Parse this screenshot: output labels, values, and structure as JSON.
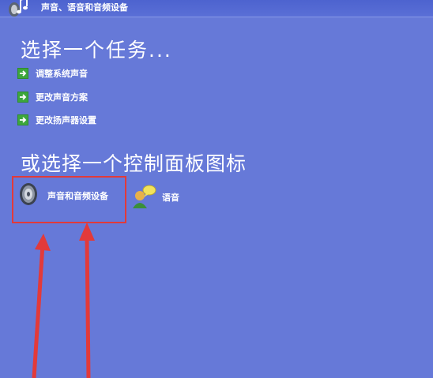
{
  "window": {
    "title": "声音、语音和音频设备"
  },
  "tasks": {
    "heading": "选择一个任务...",
    "items": [
      {
        "label": "调整系统声音"
      },
      {
        "label": "更改声音方案"
      },
      {
        "label": "更改扬声器设置"
      }
    ]
  },
  "control_panel": {
    "heading": "或选择一个控制面板图标",
    "icons": [
      {
        "label": "声音和音频设备",
        "icon": "speaker-icon"
      },
      {
        "label": "语音",
        "icon": "speech-icon"
      }
    ]
  },
  "colors": {
    "background": "#6679d8",
    "annotation": "#e23a3a"
  }
}
